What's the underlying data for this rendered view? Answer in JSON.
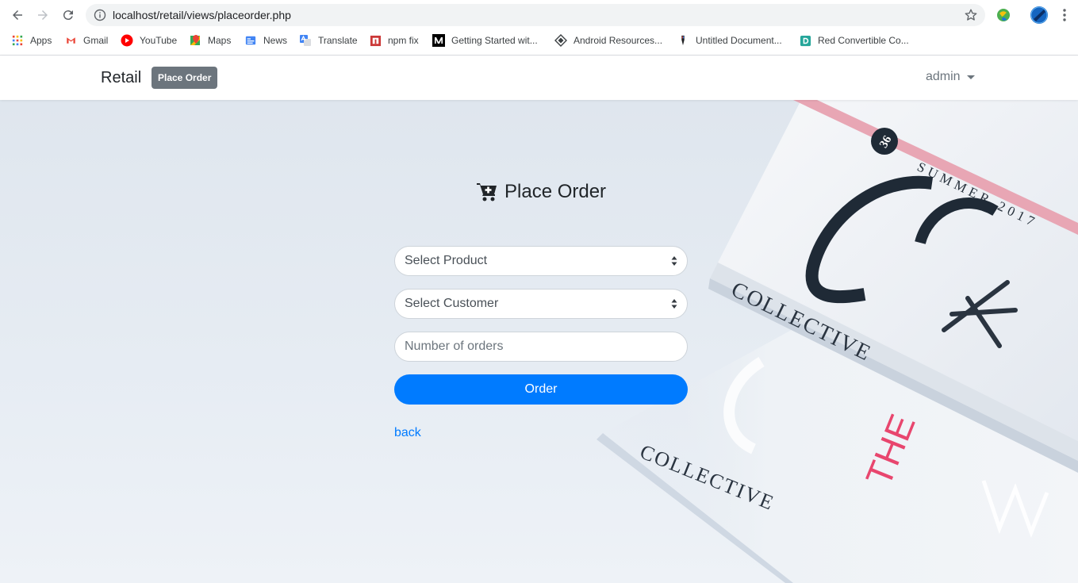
{
  "browser": {
    "url": "localhost/retail/views/placeorder.php",
    "bookmarks": [
      {
        "label": "Apps",
        "icon": "apps-grid-icon"
      },
      {
        "label": "Gmail",
        "icon": "gmail-icon"
      },
      {
        "label": "YouTube",
        "icon": "youtube-icon"
      },
      {
        "label": "Maps",
        "icon": "maps-icon"
      },
      {
        "label": "News",
        "icon": "news-icon"
      },
      {
        "label": "Translate",
        "icon": "translate-icon"
      },
      {
        "label": "npm fix",
        "icon": "npm-icon"
      },
      {
        "label": "Getting Started wit...",
        "icon": "medium-icon"
      },
      {
        "label": "Android Resources...",
        "icon": "android-resources-icon"
      },
      {
        "label": "Untitled Document...",
        "icon": "document-icon"
      },
      {
        "label": "Red Convertible Co...",
        "icon": "bookmark-d-icon"
      }
    ]
  },
  "navbar": {
    "brand": "Retail",
    "badge": "Place Order",
    "user": "admin"
  },
  "form": {
    "title": "Place Order",
    "product_select": "Select Product",
    "customer_select": "Select Customer",
    "orders_placeholder": "Number of orders",
    "submit_label": "Order",
    "back_label": "back"
  },
  "background_text": {
    "issue_number": "36",
    "season": "SUMMER 2017",
    "magazine_name": "COLLECTIVE",
    "cover_word": "THE"
  },
  "colors": {
    "primary": "#007bff",
    "badge": "#6c757d",
    "accent_pink": "#e8466e"
  }
}
